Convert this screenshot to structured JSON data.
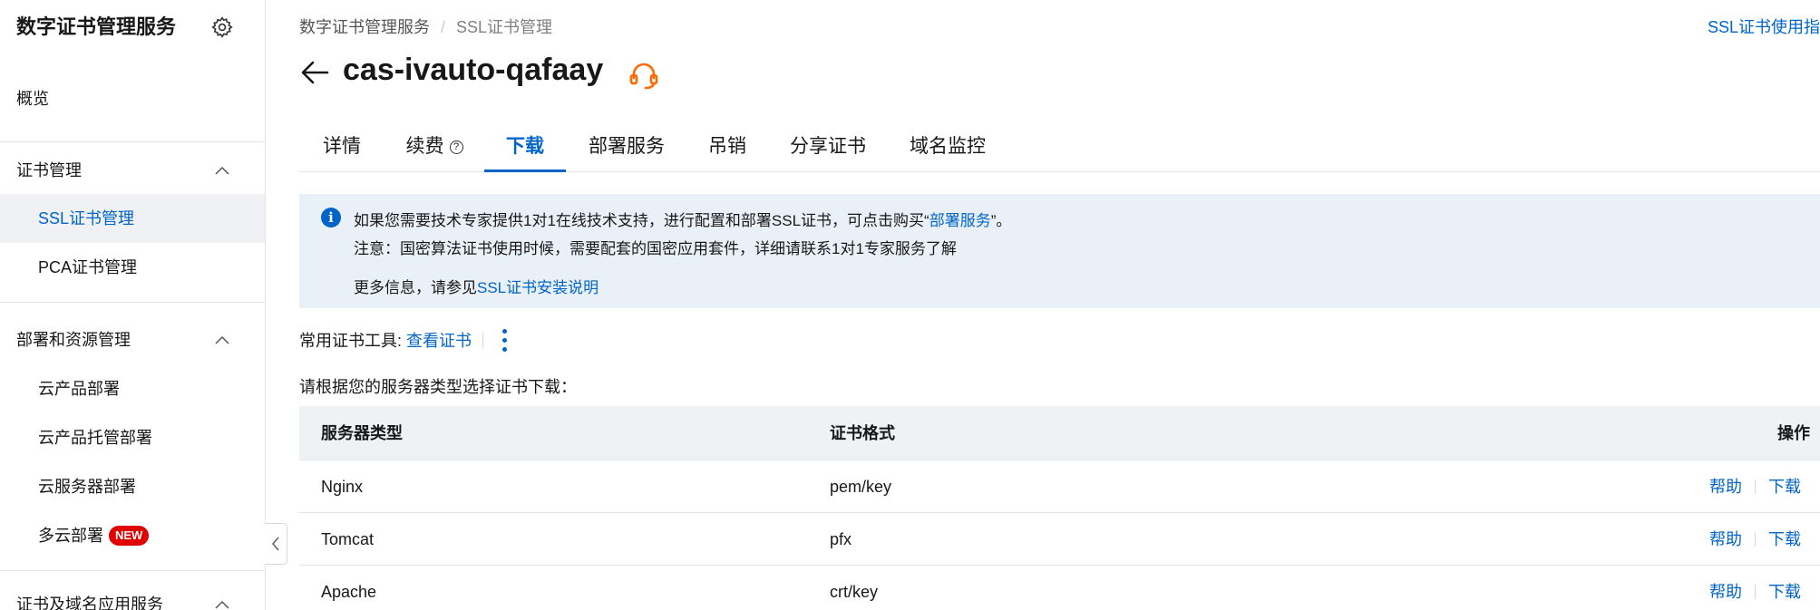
{
  "sidebar": {
    "title": "数字证书管理服务",
    "overview": "概览",
    "group_cert": "证书管理",
    "ssl": "SSL证书管理",
    "pca": "PCA证书管理",
    "group_deploy": "部署和资源管理",
    "cloud_deploy": "云产品部署",
    "cloud_hosted": "云产品托管部署",
    "server_deploy": "云服务器部署",
    "multi_cloud": "多云部署",
    "new_badge": "NEW",
    "group_app": "证书及域名应用服务"
  },
  "breadcrumb": {
    "root": "数字证书管理服务",
    "separator": "/",
    "current": "SSL证书管理"
  },
  "top_link": "SSL证书使用指南",
  "page": {
    "title": "cas-ivauto-qafaay"
  },
  "tabs": [
    {
      "label": "详情"
    },
    {
      "label": "续费",
      "help": "?"
    },
    {
      "label": "下载"
    },
    {
      "label": "部署服务"
    },
    {
      "label": "吊销"
    },
    {
      "label": "分享证书"
    },
    {
      "label": "域名监控"
    }
  ],
  "notice": {
    "info_glyph": "i",
    "line1_prefix": "如果您需要技术专家提供1对1在线技术支持，进行配置和部署SSL证书，可点击购买“",
    "line1_link": "部署服务",
    "line1_suffix": "”。",
    "line2": "注意：国密算法证书使用时候，需要配套的国密应用套件，详细请联系1对1专家服务了解",
    "line3_prefix": "更多信息，请参见",
    "line3_link": "SSL证书安装说明"
  },
  "tools": {
    "label": "常用证书工具: ",
    "view_cert": "查看证书"
  },
  "choose_text": "请根据您的服务器类型选择证书下载：",
  "table": {
    "headers": {
      "server": "服务器类型",
      "format": "证书格式",
      "action": "操作"
    },
    "rows": [
      {
        "server": "Nginx",
        "format": "pem/key",
        "help": "帮助",
        "download": "下载"
      },
      {
        "server": "Tomcat",
        "format": "pfx",
        "help": "帮助",
        "download": "下载"
      },
      {
        "server": "Apache",
        "format": "crt/key",
        "help": "帮助",
        "download": "下载"
      }
    ]
  },
  "colors": {
    "accent": "#0064c8",
    "support_icon": "#ff6a00",
    "new_badge": "#e00000",
    "notice_bg": "#eaf0f8"
  },
  "icons": [
    "gear-icon",
    "chevron-up-icon",
    "chevron-left-icon",
    "arrow-left-icon",
    "headset-icon",
    "info-icon",
    "question-icon",
    "more-vertical-icon"
  ]
}
